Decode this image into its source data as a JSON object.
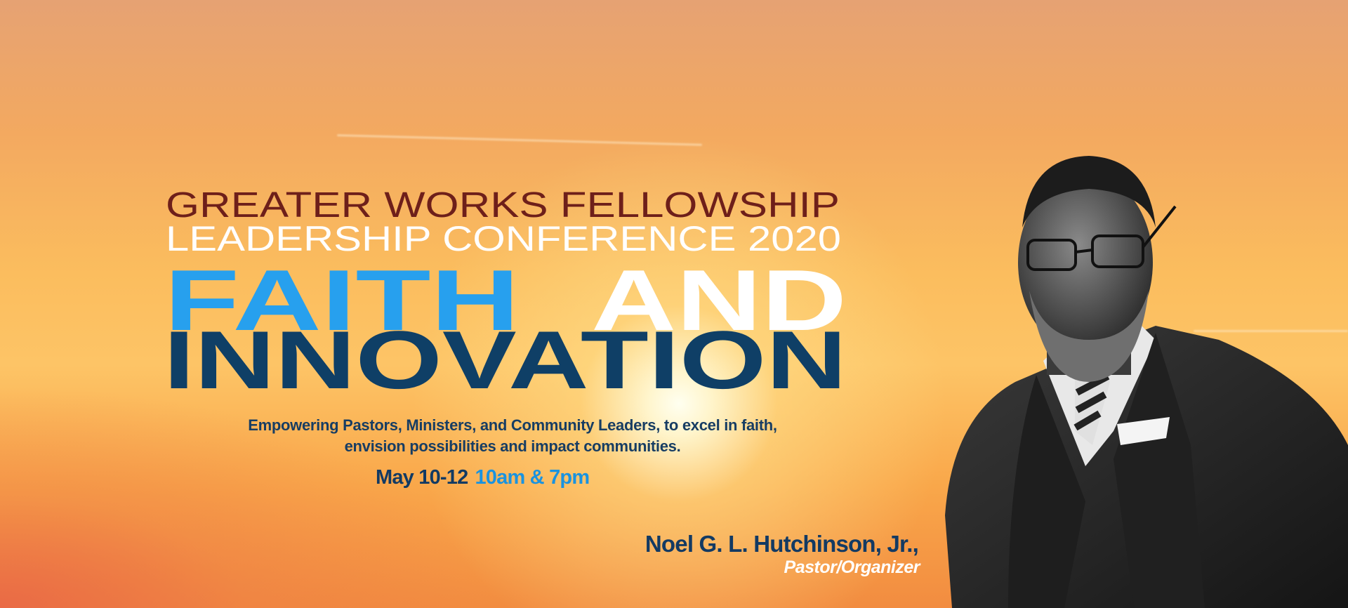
{
  "banner": {
    "org": "GREATER WORKS FELLOWSHIP",
    "event": "LEADERSHIP CONFERENCE 2020",
    "title_word1": "FAITH",
    "title_word2": "AND",
    "title_word3": "INNOVATION",
    "tagline_line1": "Empowering Pastors, Ministers, and Community Leaders,  to excel in faith,",
    "tagline_line2": "envision possibilities and impact communities.",
    "date": "May 10-12",
    "time": "10am & 7pm",
    "speaker_name": "Noel G. L. Hutchinson, Jr.,",
    "speaker_role": "Pastor/Organizer"
  },
  "colors": {
    "org": "#6e1f1a",
    "faith": "#27a0ee",
    "and": "#ffffff",
    "innovation": "#0f3f66",
    "navy": "#123a63",
    "time": "#1a93e0"
  }
}
